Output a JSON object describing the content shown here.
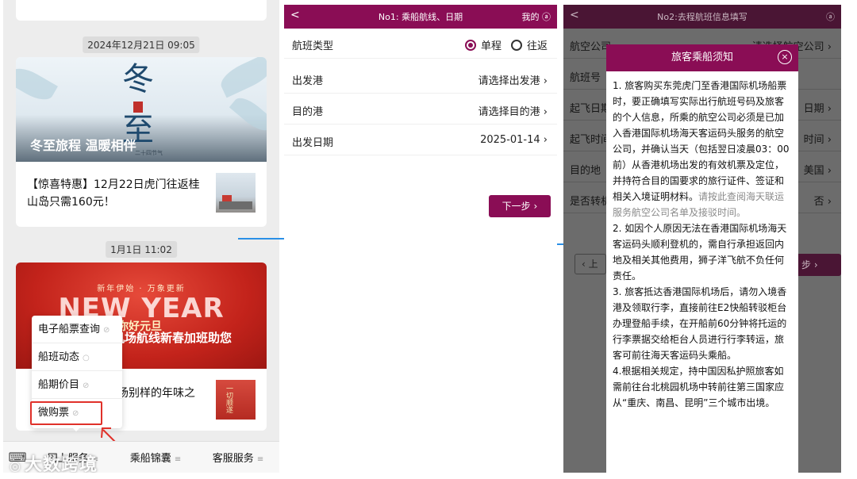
{
  "panel1": {
    "ts1": "2024年12月21日 09:05",
    "ts2": "1月1日 11:02",
    "card1": {
      "banner_char1": "冬",
      "banner_char2": "至",
      "banner_title": "冬至旅程 温暖相伴",
      "banner_sub": "二十四节气",
      "text": "【惊喜特惠】12月22日虎门往返桂山岛只需160元！"
    },
    "card2": {
      "banner_small": "新年伊始 · 万象更新",
      "banner_big": "NEW YEAR",
      "banner_greet": "你好元旦",
      "banner_title": "机场航线新春加班助您",
      "text": "场别样的年味之",
      "thumb_text": "一切顺遂"
    },
    "popup": [
      "电子船票查询",
      "船班动态",
      "船期价目",
      "微购票"
    ],
    "menu": [
      "网上服务",
      "乘船锦囊",
      "客服服务"
    ],
    "watermark": "大数跨境"
  },
  "panel2": {
    "nav": {
      "back": "<",
      "title": "No1: 乘船航线、日期",
      "mine": "我的"
    },
    "rows": [
      {
        "label": "航班类型",
        "opt1": "单程",
        "opt2": "往返"
      },
      {
        "label": "出发港",
        "value": "请选择出发港"
      },
      {
        "label": "目的港",
        "value": "请选择目的港"
      },
      {
        "label": "出发日期",
        "value": "2025-01-14"
      }
    ],
    "next": "下一步"
  },
  "panel3": {
    "nav": {
      "back": "<",
      "title": "No2:去程航班信息填写"
    },
    "rows": [
      {
        "label": "航空公司",
        "value": "请选择航空公司"
      },
      {
        "label": "航班号",
        "value": ""
      },
      {
        "label": "起飞日期",
        "value": "日期"
      },
      {
        "label": "起飞时间",
        "value": "时间"
      },
      {
        "label": "目的地",
        "value": "美国"
      },
      {
        "label": "是否转机",
        "value": "否"
      }
    ],
    "prev": "上",
    "next": "步",
    "modal": {
      "title": "旅客乘船须知",
      "close": "×",
      "p1a": "1. 旅客购买东莞虎门至香港国际机场船票时，要正确填写实际出行航班号码及旅客的个人信息，所乘的航空公司必须是已加入香港国际机场海天客运码头服务的航空公司，并确认当天（包括翌日凌晨03：00前）从香港机场出发的有效机票及定位，并持符合目的国要求的旅行证件、签证和相关入境证明材料。",
      "p1b": "请按此查阅海天联运服务航空公司名单及接驳时间。",
      "p2": "2. 如因个人原因无法在香港国际机场海天客运码头顺利登机的，需自行承担返回内地及相关其他费用，狮子洋飞航不负任何责任。",
      "p3": "3. 旅客抵达香港国际机场后，请勿入境香港及领取行李，直接前往E2快船转驳柜台办理登船手续，在开船前60分钟将托运的行李票据交给柜台人员进行行李转运，旅客可前往海天客运码头乘船。",
      "p4": "4.根据相关规定，持中国因私护照旅客如需前往台北桃园机场中转前往第三国家应从“重庆、南昌、昆明”三个城市出境。"
    }
  }
}
